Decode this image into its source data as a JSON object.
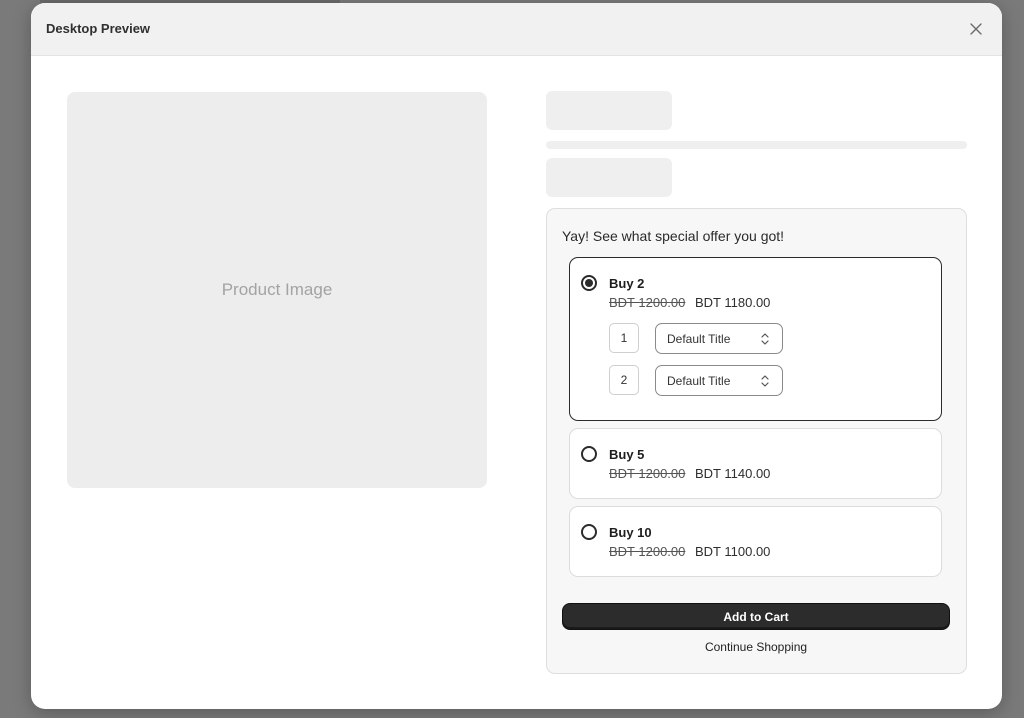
{
  "modal": {
    "title": "Desktop Preview",
    "close_icon": "close-icon"
  },
  "product": {
    "image_placeholder": "Product Image"
  },
  "offer": {
    "heading": "Yay! See what special offer you got!",
    "options": [
      {
        "title": "Buy 2",
        "old_price": "BDT 1200.00",
        "new_price": "BDT 1180.00",
        "selected": true,
        "variants": [
          {
            "qty": "1",
            "select_value": "Default Title"
          },
          {
            "qty": "2",
            "select_value": "Default Title"
          }
        ]
      },
      {
        "title": "Buy 5",
        "old_price": "BDT 1200.00",
        "new_price": "BDT 1140.00",
        "selected": false
      },
      {
        "title": "Buy 10",
        "old_price": "BDT 1200.00",
        "new_price": "BDT 1100.00",
        "selected": false
      }
    ],
    "add_to_cart_label": "Add to Cart",
    "continue_label": "Continue Shopping"
  },
  "colors": {
    "accent": "#2c2c2c",
    "panel_bg": "#f7f7f7",
    "skeleton": "#efefef"
  }
}
